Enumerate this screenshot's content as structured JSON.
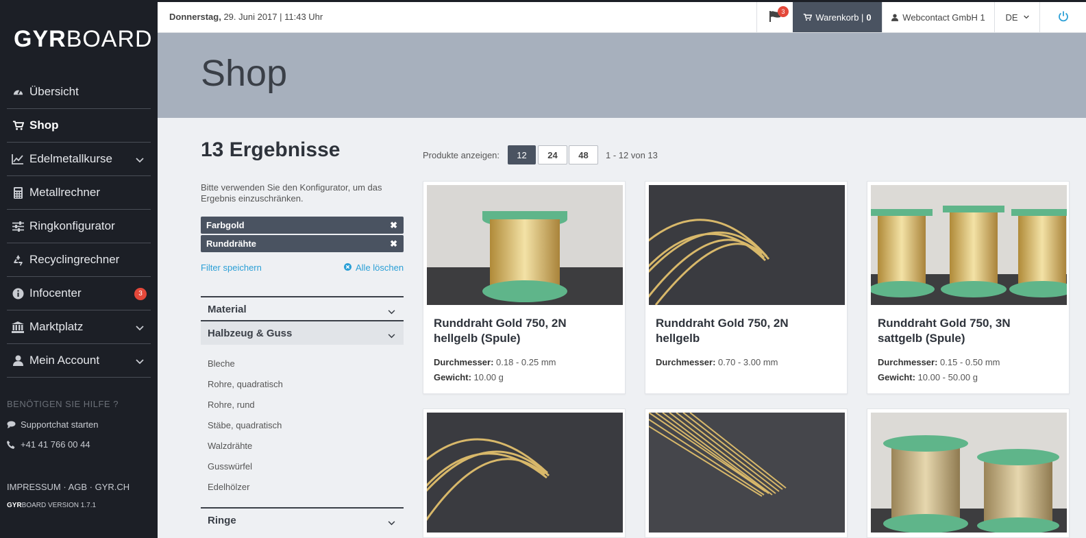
{
  "sidebar": {
    "logo_bold": "GYR",
    "logo_light": "BOARD",
    "items": [
      {
        "label": "Übersicht",
        "icon": "dashboard-icon",
        "has_chevron": false
      },
      {
        "label": "Shop",
        "icon": "cart-icon",
        "has_chevron": false,
        "active": true
      },
      {
        "label": "Edelmetallkurse",
        "icon": "chart-line-icon",
        "has_chevron": true
      },
      {
        "label": "Metallrechner",
        "icon": "calculator-icon",
        "has_chevron": false
      },
      {
        "label": "Ringkonfigurator",
        "icon": "sliders-icon",
        "has_chevron": false
      },
      {
        "label": "Recyclingrechner",
        "icon": "recycle-icon",
        "has_chevron": false
      },
      {
        "label": "Infocenter",
        "icon": "info-icon",
        "has_chevron": false,
        "badge": "3"
      },
      {
        "label": "Marktplatz",
        "icon": "bank-icon",
        "has_chevron": true
      },
      {
        "label": "Mein Account",
        "icon": "user-icon",
        "has_chevron": true
      }
    ],
    "help_title": "BENÖTIGEN SIE HILFE ?",
    "support_chat": "Supportchat starten",
    "phone": "+41 41 766 00 44",
    "footer_links": "IMPRESSUM · AGB · GYR.CH",
    "version_brand": "GYR",
    "version_rest": "BOARD VERSION 1.7.1"
  },
  "topbar": {
    "date_bold": "Donnerstag,",
    "date_rest": " 29. Juni 2017 | 11:43 Uhr",
    "notification_count": "3",
    "cart_label": "Warenkorb |",
    "cart_count": "0",
    "user": "Webcontact GmbH 1",
    "language": "DE"
  },
  "hero": {
    "title": "Shop"
  },
  "filters": {
    "results": "13 Ergebnisse",
    "hint": "Bitte verwenden Sie den Konfigurator, um das Ergebnis einzuschränken.",
    "chips": [
      "Farbgold",
      "Runddrähte"
    ],
    "save_label": "Filter speichern",
    "clear_label": "Alle löschen",
    "sections": [
      "Material",
      "Halbzeug & Guss",
      "Ringe"
    ],
    "subitems": [
      "Bleche",
      "Rohre, quadratisch",
      "Rohre, rund",
      "Stäbe, quadratisch",
      "Walzdrähte",
      "Gusswürfel",
      "Edelhölzer"
    ]
  },
  "paging": {
    "label": "Produkte anzeigen:",
    "options": [
      "12",
      "24",
      "48"
    ],
    "selected": "12",
    "info": "1 - 12 von 13"
  },
  "products": [
    {
      "title": "Runddraht Gold 750, 2N hellgelb (Spule)",
      "diameter_label": "Durchmesser:",
      "diameter": " 0.18 - 0.25 mm",
      "weight_label": "Gewicht:",
      "weight": " 10.00 g",
      "image": "spool"
    },
    {
      "title": "Runddraht Gold 750, 2N hellgelb",
      "diameter_label": "Durchmesser:",
      "diameter": " 0.70 - 3.00 mm",
      "image": "coil"
    },
    {
      "title": "Runddraht Gold 750, 3N sattgelb (Spule)",
      "diameter_label": "Durchmesser:",
      "diameter": " 0.15 - 0.50 mm",
      "weight_label": "Gewicht:",
      "weight": " 10.00 - 50.00 g",
      "image": "spools"
    },
    {
      "title": "",
      "image": "coil"
    },
    {
      "title": "",
      "image": "rods"
    },
    {
      "title": "",
      "image": "spools2"
    }
  ],
  "colors": {
    "sidebar_bg": "#1c1f26",
    "accent": "#2a9fd6",
    "badge": "#e4483a",
    "dark_button": "#4a5361"
  }
}
